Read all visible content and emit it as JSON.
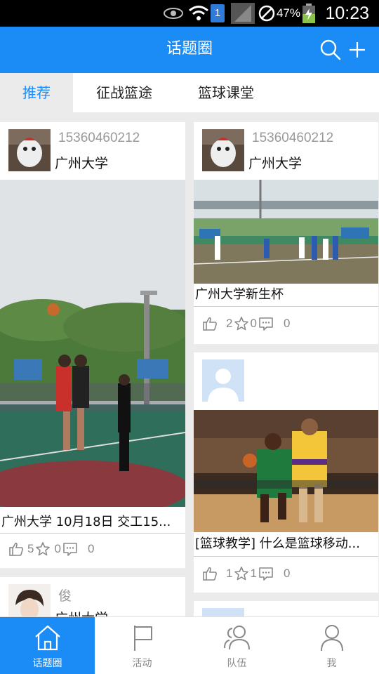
{
  "status_bar": {
    "sim_label": "1",
    "battery_percent": "47%",
    "time": "10:23"
  },
  "header": {
    "title": "话题圈"
  },
  "tabs": [
    {
      "label": "推荐",
      "active": true
    },
    {
      "label": "征战篮途",
      "active": false
    },
    {
      "label": "篮球课堂",
      "active": false
    }
  ],
  "feed": {
    "left": [
      {
        "user_name": "15360460212",
        "school": "广州大学",
        "caption": "广州大学 10月18日 交工15...",
        "likes": "5",
        "stars": "0",
        "comments": "0"
      },
      {
        "user_name": "俊",
        "school": "广州大学"
      }
    ],
    "right": [
      {
        "user_name": "15360460212",
        "school": "广州大学",
        "caption": "广州大学新生杯",
        "likes": "2",
        "stars": "0",
        "comments": "0"
      },
      {
        "caption": "[篮球教学] 什么是篮球移动...",
        "likes": "1",
        "stars": "1",
        "comments": "0"
      }
    ]
  },
  "bottom_nav": [
    {
      "label": "话题圈",
      "icon": "home-icon",
      "active": true
    },
    {
      "label": "活动",
      "icon": "flag-icon",
      "active": false
    },
    {
      "label": "队伍",
      "icon": "group-icon",
      "active": false
    },
    {
      "label": "我",
      "icon": "person-icon",
      "active": false
    }
  ],
  "colors": {
    "brand": "#1b8bf5",
    "background": "#ebebeb"
  }
}
